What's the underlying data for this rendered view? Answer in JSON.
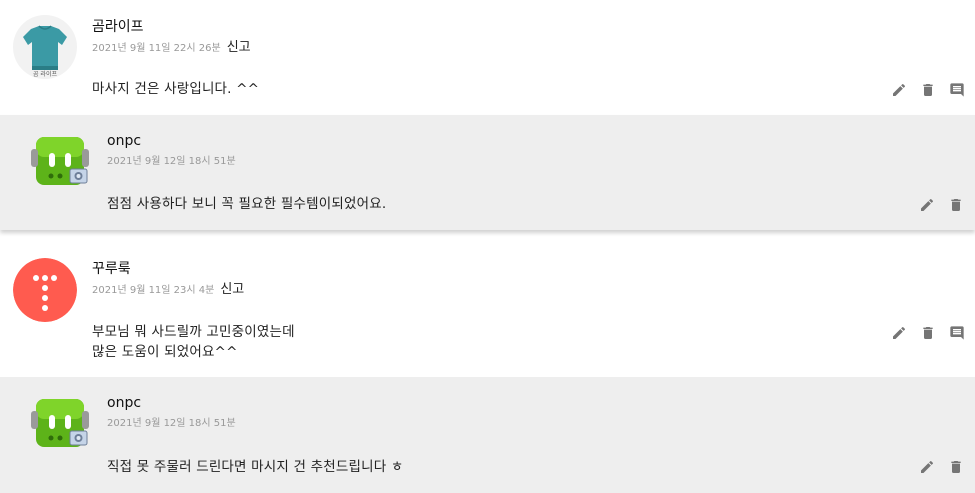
{
  "comments": [
    {
      "author": "곰라이프",
      "date": "2021년 9월 11일 22시 26분",
      "report_label": "신고",
      "body": [
        "마사지 건은 사랑입니다. ^^"
      ],
      "avatar_caption": "곰 라이프"
    },
    {
      "author": "onpc",
      "date": "2021년 9월 12일 18시 51분",
      "body": [
        "점점 사용하다 보니 꼭 필요한 필수템이되었어요."
      ]
    },
    {
      "author": "꾸루룩",
      "date": "2021년 9월 11일 23시 4분",
      "report_label": "신고",
      "body": [
        "부모님 뭐 사드릴까 고민중이였는데",
        "많은 도움이 되었어요^^"
      ]
    },
    {
      "author": "onpc",
      "date": "2021년 9월 12일 18시 51분",
      "body": [
        "직접 못 주물러 드린다면 마시지 건 추천드립니다 ㅎ"
      ]
    }
  ],
  "icons": {
    "edit": "pencil-icon",
    "delete": "trash-icon",
    "reply": "comment-icon",
    "color": "#757575"
  }
}
